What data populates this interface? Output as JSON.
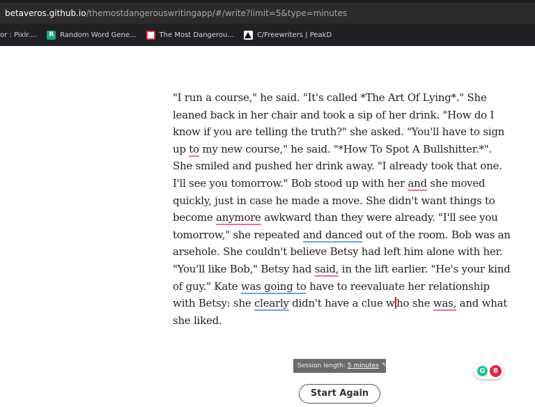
{
  "browser": {
    "url_host": "betaveros.github.io",
    "url_path": "/themostdangerouswritingapp/#/write?limit=5&type=minutes",
    "bookmarks": [
      {
        "label": "or : Pixlr...."
      },
      {
        "label": "Random Word Gene...",
        "icon_letter": "R"
      },
      {
        "label": "The Most Dangerou..."
      },
      {
        "label": "C/Freewriters | PeakD"
      }
    ]
  },
  "editor": {
    "t1": "\"I run a course,\" he said. \"It's called *The Art Of Lying*.\" She leaned back in her chair and took a sip of her drink. \"How do I know if you are telling the truth?\" she asked. \"You'll have to sign up ",
    "w_to": "to",
    "t2": " my new course,\" he said. \"*How To Spot A Bullshitter.*\". She smiled and pushed her drink away. \"I already took that one. I'll see you tomorrow.\" Bob stood up with her ",
    "w_and": "and",
    "t3": " she moved quickly, just in case he made a move. She didn't want things to become ",
    "w_anymore": "anymore",
    "t4": " awkward than they were already. \"I'll see you tomorrow,\" she repeated ",
    "w_and_danced": "and danced",
    "t5": " out of the room. Bob was an arsehole. She couldn't believe Betsy had left him alone with her. \"You'll like Bob,\" Betsy had ",
    "w_said": "said,",
    "t6": " in the lift earlier. \"He's your kind of guy.\" Kate ",
    "w_was_going_to": "was going to",
    "t7": " have to reevaluate her relationship with Betsy: she ",
    "w_clearly": "clearly",
    "t8": " didn't have a clue w",
    "t9": "ho she ",
    "w_was": "was,",
    "t10": " and what she liked."
  },
  "session": {
    "label": "Session length:",
    "length": "5 minutes",
    "pencil_icon": "✎"
  },
  "start_again_label": "Start Again",
  "grammarly": {
    "logo": "G",
    "count": "8"
  }
}
